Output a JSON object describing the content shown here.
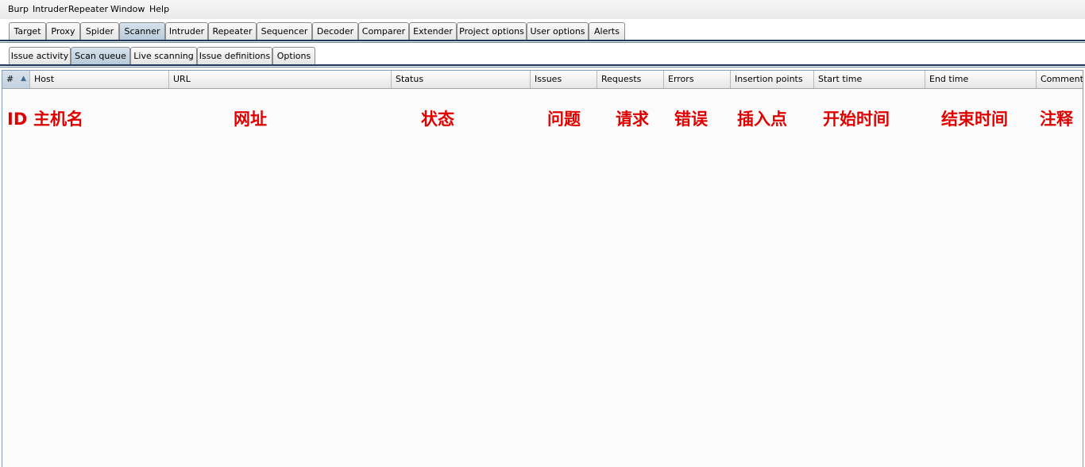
{
  "menu": [
    "Burp",
    "Intruder",
    "Repeater",
    "Window",
    "Help"
  ],
  "main_tabs": [
    {
      "label": "Target"
    },
    {
      "label": "Proxy"
    },
    {
      "label": "Spider"
    },
    {
      "label": "Scanner",
      "active": true
    },
    {
      "label": "Intruder"
    },
    {
      "label": "Repeater"
    },
    {
      "label": "Sequencer"
    },
    {
      "label": "Decoder"
    },
    {
      "label": "Comparer"
    },
    {
      "label": "Extender"
    },
    {
      "label": "Project options"
    },
    {
      "label": "User options"
    },
    {
      "label": "Alerts"
    }
  ],
  "sub_tabs": [
    {
      "label": "Issue activity"
    },
    {
      "label": "Scan queue",
      "active": true
    },
    {
      "label": "Live scanning"
    },
    {
      "label": "Issue definitions"
    },
    {
      "label": "Options"
    }
  ],
  "table": {
    "columns": [
      "#",
      "Host",
      "URL",
      "Status",
      "Issues",
      "Requests",
      "Errors",
      "Insertion points",
      "Start time",
      "End time",
      "Comment"
    ],
    "sort_indicator": "▲"
  },
  "annotations": [
    "ID",
    "主机名",
    "网址",
    "状态",
    "问题",
    "请求",
    "错误",
    "插入点",
    "开始时间",
    "结束时间",
    "注释"
  ],
  "colors": {
    "annotation": "#e00000",
    "active_tab": "#c4d3e0",
    "tab_border": "#8c8c8c"
  }
}
